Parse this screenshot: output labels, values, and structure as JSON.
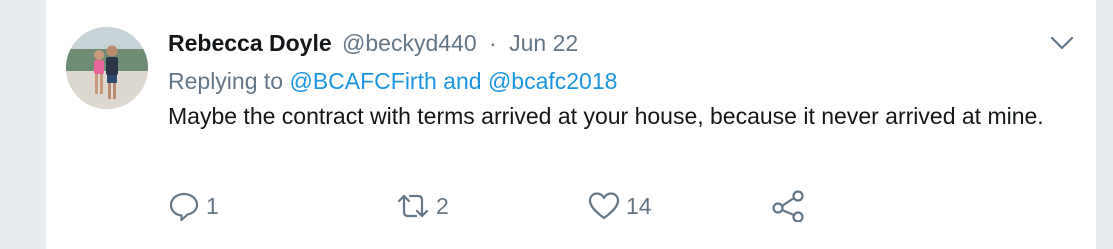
{
  "tweet": {
    "author_name": "Rebecca Doyle",
    "author_handle": "@beckyd440",
    "separator": "·",
    "date": "Jun 22",
    "replying_prefix": "Replying to",
    "reply_mentions": [
      "@BCAFCFirth",
      "@bcafc2018"
    ],
    "reply_joiner": "and",
    "text": "Maybe the contract with terms arrived at your house, because it never arrived at mine."
  },
  "actions": {
    "reply_count": "1",
    "retweet_count": "2",
    "like_count": "14"
  },
  "icons": {
    "reply": "reply-icon",
    "retweet": "retweet-icon",
    "like": "heart-icon",
    "share": "share-icon",
    "more": "chevron-down-icon"
  },
  "colors": {
    "link": "#1b95e0",
    "secondary_text": "#657786",
    "primary_text": "#14171a",
    "background": "#e6ecf0"
  }
}
